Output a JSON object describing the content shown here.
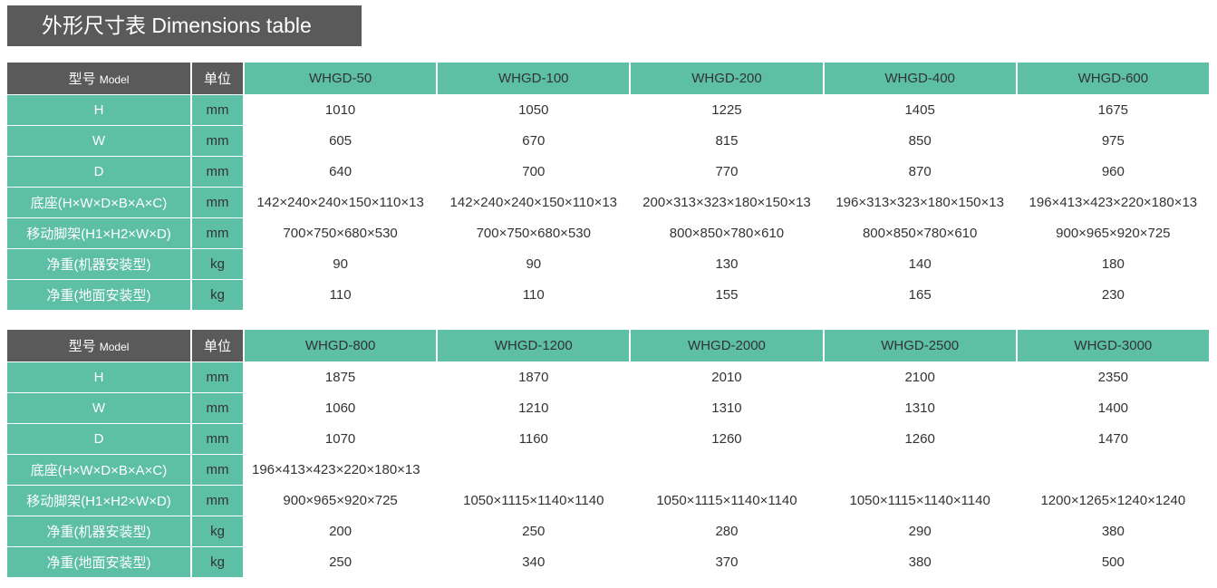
{
  "title": "外形尺寸表  Dimensions table",
  "header": {
    "model_zh": "型号",
    "model_en": "Model",
    "unit": "单位"
  },
  "tables": [
    {
      "models": [
        "WHGD-50",
        "WHGD-100",
        "WHGD-200",
        "WHGD-400",
        "WHGD-600"
      ],
      "rows": [
        {
          "label": "H",
          "unit": "mm",
          "values": [
            "1010",
            "1050",
            "1225",
            "1405",
            "1675"
          ]
        },
        {
          "label": "W",
          "unit": "mm",
          "values": [
            "605",
            "670",
            "815",
            "850",
            "975"
          ]
        },
        {
          "label": "D",
          "unit": "mm",
          "values": [
            "640",
            "700",
            "770",
            "870",
            "960"
          ]
        },
        {
          "label": "底座(H×W×D×B×A×C)",
          "unit": "mm",
          "values": [
            "142×240×240×150×110×13",
            "142×240×240×150×110×13",
            "200×313×323×180×150×13",
            "196×313×323×180×150×13",
            "196×413×423×220×180×13"
          ]
        },
        {
          "label": "移动脚架(H1×H2×W×D)",
          "unit": "mm",
          "values": [
            "700×750×680×530",
            "700×750×680×530",
            "800×850×780×610",
            "800×850×780×610",
            "900×965×920×725"
          ]
        },
        {
          "label": "净重(机器安装型)",
          "unit": "kg",
          "values": [
            "90",
            "90",
            "130",
            "140",
            "180"
          ]
        },
        {
          "label": "净重(地面安装型)",
          "unit": "kg",
          "values": [
            "110",
            "110",
            "155",
            "165",
            "230"
          ]
        }
      ]
    },
    {
      "models": [
        "WHGD-800",
        "WHGD-1200",
        "WHGD-2000",
        "WHGD-2500",
        "WHGD-3000"
      ],
      "rows": [
        {
          "label": "H",
          "unit": "mm",
          "values": [
            "1875",
            "1870",
            "2010",
            "2100",
            "2350"
          ]
        },
        {
          "label": "W",
          "unit": "mm",
          "values": [
            "1060",
            "1210",
            "1310",
            "1310",
            "1400"
          ]
        },
        {
          "label": "D",
          "unit": "mm",
          "values": [
            "1070",
            "1160",
            "1260",
            "1260",
            "1470"
          ]
        },
        {
          "label": "底座(H×W×D×B×A×C)",
          "unit": "mm",
          "values": [
            "196×413×423×220×180×13",
            "",
            "",
            "",
            ""
          ]
        },
        {
          "label": "移动脚架(H1×H2×W×D)",
          "unit": "mm",
          "values": [
            "900×965×920×725",
            "1050×1115×1140×1140",
            "1050×1115×1140×1140",
            "1050×1115×1140×1140",
            "1200×1265×1240×1240"
          ]
        },
        {
          "label": "净重(机器安装型)",
          "unit": "kg",
          "values": [
            "200",
            "250",
            "280",
            "290",
            "380"
          ]
        },
        {
          "label": "净重(地面安装型)",
          "unit": "kg",
          "values": [
            "250",
            "340",
            "370",
            "380",
            "500"
          ]
        }
      ]
    }
  ]
}
